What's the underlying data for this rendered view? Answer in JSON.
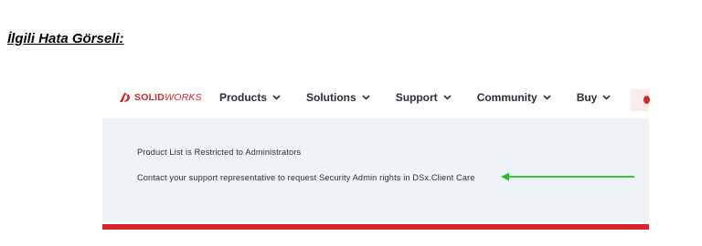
{
  "document": {
    "heading": "İlgili Hata Görseli:"
  },
  "site": {
    "logo": {
      "solid": "SOLID",
      "works": "WORKS",
      "icon": "ds-solidworks-logo"
    },
    "nav": [
      {
        "label": "Products",
        "icon": "chevron-down-icon"
      },
      {
        "label": "Solutions",
        "icon": "chevron-down-icon"
      },
      {
        "label": "Support",
        "icon": "chevron-down-icon"
      },
      {
        "label": "Community",
        "icon": "chevron-down-icon"
      },
      {
        "label": "Buy",
        "icon": "chevron-down-icon"
      }
    ]
  },
  "message": {
    "line1": "Product List is Restricted to Administrators",
    "line2": "Contact your support representative to request Security Admin rights in DSx.Client Care"
  },
  "colors": {
    "brand_red": "#d0262c",
    "content_bg": "#eef3f7",
    "arrow_green": "#22c022"
  }
}
